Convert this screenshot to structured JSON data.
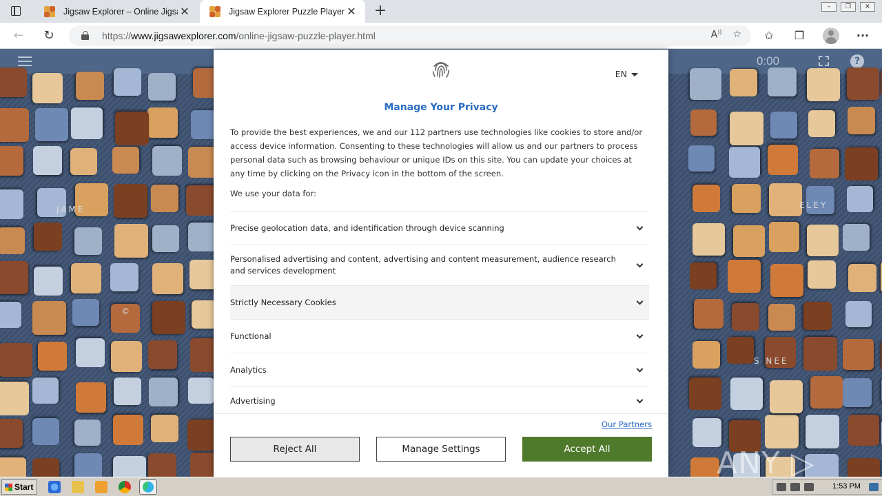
{
  "browser": {
    "tabs": [
      {
        "title": "Jigsaw Explorer – Online Jigsaw",
        "close": "✕",
        "active": false
      },
      {
        "title": "Jigsaw Explorer Puzzle Player",
        "close": "✕",
        "active": true
      }
    ],
    "new_tab": "+",
    "url_prefix": "https://",
    "url_host": "www.jigsawexplorer.com",
    "url_path": "/online-jigsaw-puzzle-player.html",
    "window_controls": [
      "–",
      "❐",
      "✕"
    ]
  },
  "app": {
    "timer": "0:00",
    "help": "?",
    "piece_labels": [
      "JAME",
      "ELEY",
      "S NEE",
      "©"
    ],
    "watermark": "ANY ▷ RUN"
  },
  "privacy_dialog": {
    "language": "EN",
    "title": "Manage Your Privacy",
    "body": "To provide the best experiences, we and our 112 partners use technologies like cookies to store and/or access device information. Consenting to these technologies will allow us and our partners to process personal data such as browsing behaviour or unique IDs on this site. You can update your choices at any time by clicking on the Privacy icon in the bottom of the screen.",
    "subheading": "We use your data for:",
    "categories": [
      {
        "label": "Precise geolocation data, and identification through device scanning"
      },
      {
        "label": "Personalised advertising and content, advertising and content measurement, audience research and services development"
      },
      {
        "label": "Strictly Necessary Cookies"
      },
      {
        "label": "Functional"
      },
      {
        "label": "Analytics"
      },
      {
        "label": "Advertising"
      }
    ],
    "partners_link": "Our Partners",
    "buttons": {
      "reject": "Reject All",
      "manage": "Manage Settings",
      "accept": "Accept All"
    },
    "accent_color": "#2a6cc1",
    "accept_color": "#4f7a2c"
  },
  "taskbar": {
    "start_label": "Start",
    "clock": "1:53 PM"
  }
}
